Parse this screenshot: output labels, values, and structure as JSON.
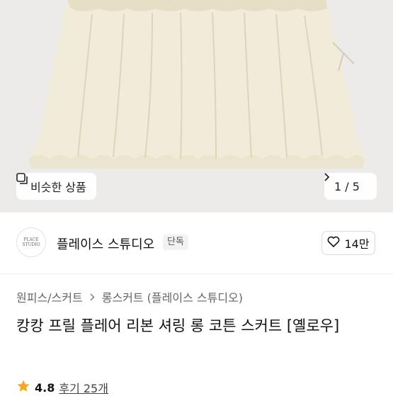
{
  "hero": {
    "similar_label": "비슷한 상품",
    "pager": "1 / 5"
  },
  "store": {
    "name": "플레이스 스튜디오",
    "badge": "단독",
    "avatar_text": "PLACE STUDIO",
    "likes": "14만"
  },
  "product": {
    "breadcrumb": [
      "원피스/스커트",
      "롱스커트 (플레이스 스튜디오)"
    ],
    "title": "캉캉 프릴 플레어 리본 셔링 롱 코튼 스커트 [옐로우]",
    "rating": "4.8",
    "reviews": "후기 25개"
  },
  "colors": {
    "star": "#f5a623",
    "skirt": "#f1ecd9",
    "bg": "#ecebe9"
  },
  "icons": [
    "similar-icon",
    "chevron-right-icon",
    "heart-icon",
    "star-icon"
  ]
}
